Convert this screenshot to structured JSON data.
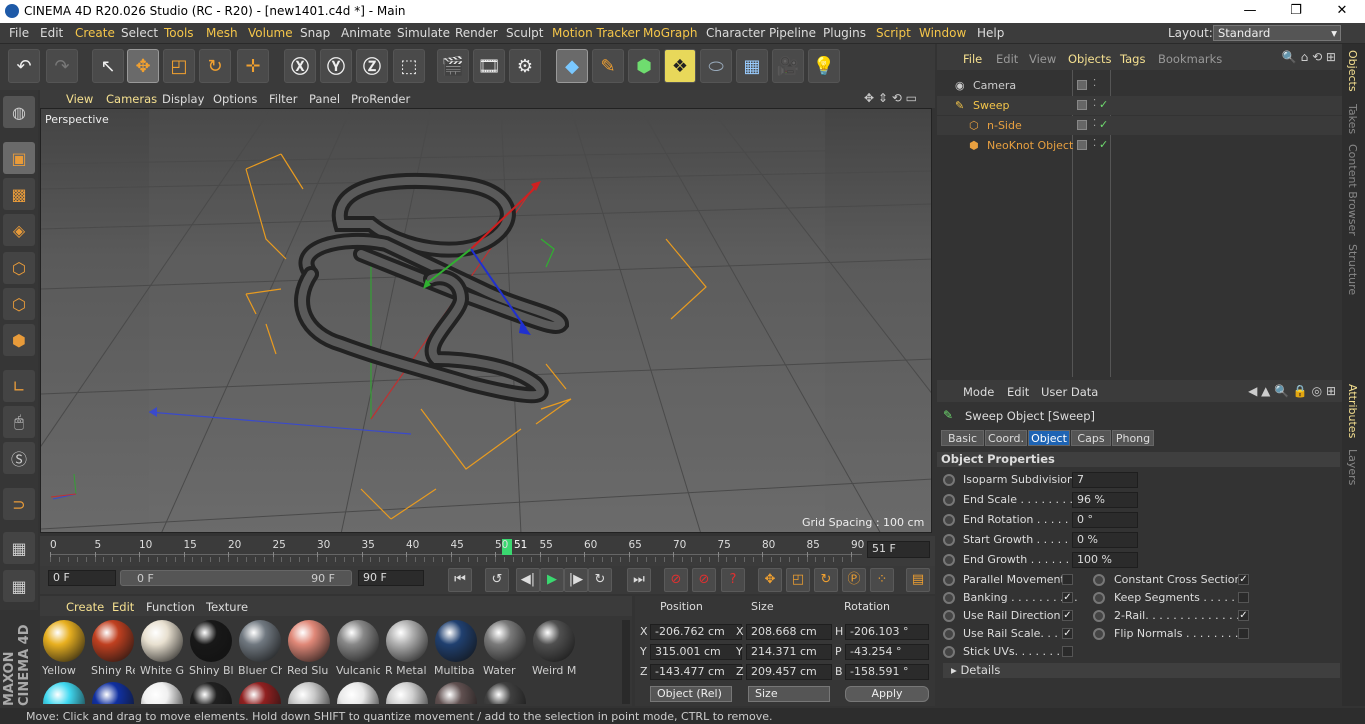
{
  "window": {
    "title": "CINEMA 4D R20.026 Studio (RC - R20) - [new1401.c4d *] - Main"
  },
  "menu": [
    "File",
    "Edit",
    "Create",
    "Select",
    "Tools",
    "Mesh",
    "Volume",
    "Snap",
    "Animate",
    "Simulate",
    "Render",
    "Sculpt",
    "Motion Tracker",
    "MoGraph",
    "Character",
    "Pipeline",
    "Plugins",
    "Script",
    "Window",
    "Help"
  ],
  "layout": {
    "label": "Layout:",
    "value": "Standard"
  },
  "viewport": {
    "menu": [
      "View",
      "Cameras",
      "Display",
      "Options",
      "Filter",
      "Panel",
      "ProRender"
    ],
    "camera": "Perspective",
    "grid": "Grid Spacing : 100 cm"
  },
  "timeline": {
    "ticks": [
      "0",
      "5",
      "10",
      "15",
      "20",
      "25",
      "30",
      "35",
      "40",
      "45",
      "50",
      "55",
      "60",
      "65",
      "70",
      "75",
      "80",
      "85",
      "90"
    ],
    "current": "51",
    "frame_field": "51 F"
  },
  "tlctrl": {
    "start": "0 F",
    "range_start": "0 F",
    "range_end": "90 F",
    "end": "90 F"
  },
  "materials": {
    "menu": [
      "Create",
      "Edit",
      "Function",
      "Texture"
    ],
    "row1": [
      {
        "name": "Yellow",
        "color": "#e8b020"
      },
      {
        "name": "Shiny Re",
        "color": "#c04020"
      },
      {
        "name": "White G",
        "color": "#e8e0d0"
      },
      {
        "name": "Shiny Bl",
        "color": "#181818"
      },
      {
        "name": "Bluer Ch",
        "color": "#707880"
      },
      {
        "name": "Red Slu",
        "color": "#e08878"
      },
      {
        "name": "Vulcanic",
        "color": "#888"
      },
      {
        "name": "R Metal",
        "color": "#b0b0b0"
      },
      {
        "name": "Multiba",
        "color": "#204070"
      },
      {
        "name": "Water",
        "color": "#7a7a7a"
      },
      {
        "name": "Weird M",
        "color": "#505050"
      }
    ],
    "row2": [
      "#40d8f0",
      "#1030a0",
      "#f0f0f0",
      "#202020",
      "#902020",
      "#c8c8c8",
      "#e8e8e8",
      "#d0d0d0",
      "#605050",
      "#404040"
    ]
  },
  "coords": {
    "headers": [
      "Position",
      "Size",
      "Rotation"
    ],
    "rows": [
      {
        "a": "X",
        "p": "-206.762 cm",
        "b": "X",
        "s": "208.668 cm",
        "c": "H",
        "r": "-206.103 °"
      },
      {
        "a": "Y",
        "p": "315.001 cm",
        "b": "Y",
        "s": "214.371 cm",
        "c": "P",
        "r": "-43.254 °"
      },
      {
        "a": "Z",
        "p": "-143.477 cm",
        "b": "Z",
        "s": "209.457 cm",
        "c": "B",
        "r": "-158.591 °"
      }
    ],
    "mode": "Object (Rel)",
    "size_mode": "Size",
    "apply": "Apply"
  },
  "objects": {
    "menu": [
      "File",
      "Edit",
      "View",
      "Objects",
      "Tags",
      "Bookmarks"
    ],
    "items": [
      {
        "name": "Camera",
        "color": "#ccc",
        "indent": 0
      },
      {
        "name": "Sweep",
        "color": "#f5c64a",
        "indent": 0
      },
      {
        "name": "n-Side",
        "color": "#e8a040",
        "indent": 1
      },
      {
        "name": "NeoKnot Object",
        "color": "#e8a040",
        "indent": 1
      }
    ]
  },
  "attributes": {
    "menu": [
      "Mode",
      "Edit",
      "User Data"
    ],
    "title": "Sweep Object [Sweep]",
    "tabs": [
      "Basic",
      "Coord.",
      "Object",
      "Caps",
      "Phong"
    ],
    "section": "Object Properties",
    "fields": [
      {
        "label": "Isoparm Subdivision",
        "value": "7"
      },
      {
        "label": "End Scale . . . . . . . . . .",
        "value": "96 %"
      },
      {
        "label": "End Rotation . . . . . .",
        "value": "0 °"
      },
      {
        "label": "Start Growth . . . . . .",
        "value": "0 %"
      },
      {
        "label": "End Growth . . . . . . .",
        "value": "100 %"
      }
    ],
    "checks_left": [
      {
        "label": "Parallel Movement",
        "checked": false
      },
      {
        "label": "Banking . . . . . . . . . .",
        "checked": true
      },
      {
        "label": "Use Rail Direction",
        "checked": true
      },
      {
        "label": "Use Rail Scale. . . .",
        "checked": true
      },
      {
        "label": "Stick UVs. . . . . . . .",
        "checked": false
      }
    ],
    "checks_right": [
      {
        "label": "Constant Cross Section",
        "checked": true
      },
      {
        "label": "Keep Segments . . . . . .",
        "checked": false
      },
      {
        "label": "2-Rail. . . . . . . . . . . . . .",
        "checked": true
      },
      {
        "label": "Flip Normals . . . . . . . . .",
        "checked": false
      }
    ],
    "details": "Details"
  },
  "sidetabs": [
    "Objects",
    "Takes",
    "Content Browser",
    "Structure",
    "Attributes",
    "Layers"
  ],
  "brand": "MAXON CINEMA 4D",
  "status": "Move: Click and drag to move elements. Hold down SHIFT to quantize movement / add to the selection in point mode, CTRL to remove."
}
